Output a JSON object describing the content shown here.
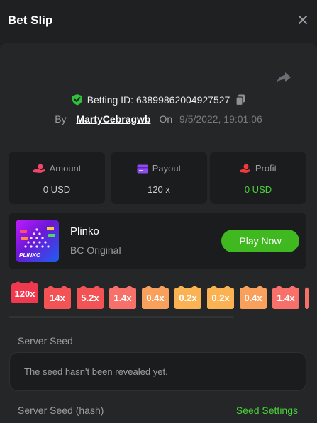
{
  "header": {
    "title": "Bet Slip"
  },
  "bet": {
    "id_label": "Betting ID: 638998620049275​27",
    "by_label": "By",
    "user": "MartyCebragwb",
    "on_label": "On",
    "date": "9/5/2022, 19:01:06"
  },
  "stats": [
    {
      "label": "Amount",
      "value": "0 USD",
      "icon": "coins-hand-icon",
      "color": "#f1456c"
    },
    {
      "label": "Payout",
      "value": "120 x",
      "icon": "card-icon",
      "color": "#8c4cf0"
    },
    {
      "label": "Profit",
      "value": "0 USD",
      "icon": "money-hand-icon",
      "color": "#f13b3b"
    }
  ],
  "game": {
    "name": "Plinko",
    "provider": "BC Original",
    "thumb_text": "PLINKO",
    "play_label": "Play Now"
  },
  "multipliers": [
    {
      "label": "120x",
      "color": "#f0384f"
    },
    {
      "label": "14x",
      "color": "#f45356"
    },
    {
      "label": "5.2x",
      "color": "#f45356"
    },
    {
      "label": "1.4x",
      "color": "#f7716a"
    },
    {
      "label": "0.4x",
      "color": "#f8a05c"
    },
    {
      "label": "0.2x",
      "color": "#fbb252"
    },
    {
      "label": "0.2x",
      "color": "#fbb252"
    },
    {
      "label": "0.4x",
      "color": "#f8a05c"
    },
    {
      "label": "1.4x",
      "color": "#f7716a"
    }
  ],
  "seeds": {
    "server_seed_label": "Server Seed",
    "server_seed_value": "The seed hasn't been revealed yet.",
    "server_seed_hash_label": "Server Seed (hash)",
    "seed_settings_label": "Seed Settings"
  },
  "colors": {
    "accent_green": "#3fb91f",
    "background": "#1e2022",
    "panel": "#242628",
    "card": "#1b1c1e"
  }
}
